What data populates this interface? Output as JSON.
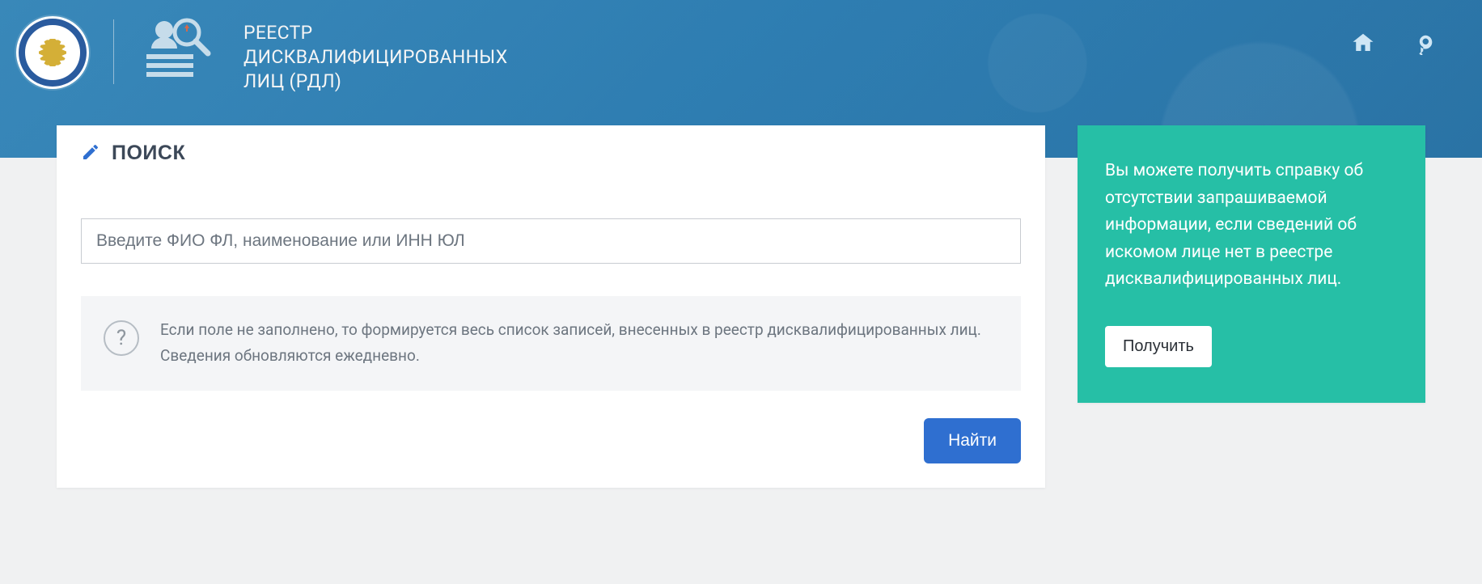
{
  "header": {
    "title_lines": [
      "РЕЕСТР",
      "ДИСКВАЛИФИЦИРОВАННЫХ",
      "ЛИЦ (РДЛ)"
    ]
  },
  "panel": {
    "heading": "ПОИСК",
    "search_placeholder": "Введите ФИО ФЛ, наименование или ИНН ЮЛ",
    "hint_line1": "Если поле не заполнено, то формируется весь список записей, внесенных в реестр дисквалифицированных лиц.",
    "hint_line2": "Сведения обновляются ежедневно.",
    "find_label": "Найти"
  },
  "side": {
    "text": "Вы можете получить справку об отсутствии запрашиваемой информации, если сведений об искомом лице нет в реестре дисквалифицированных лиц.",
    "get_label": "Получить"
  },
  "icons": {
    "pencil": "pencil-icon",
    "question": "?"
  }
}
